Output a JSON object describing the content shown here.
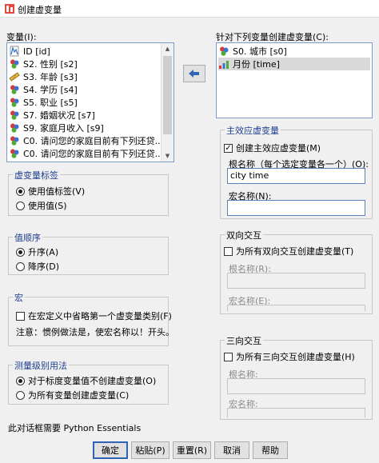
{
  "window": {
    "title": "创建虚变量"
  },
  "variables": {
    "label": "变量(I):",
    "items": [
      {
        "name": "ID [id]",
        "icon": "scale-icon"
      },
      {
        "name": "S2. 性别 [s2]",
        "icon": "nominal-icon"
      },
      {
        "name": "S3. 年龄 [s3]",
        "icon": "ruler-icon"
      },
      {
        "name": "S4. 学历 [s4]",
        "icon": "nominal-icon"
      },
      {
        "name": "S5. 职业 [s5]",
        "icon": "nominal-icon"
      },
      {
        "name": "S7. 婚姻状况 [s7]",
        "icon": "nominal-icon"
      },
      {
        "name": "S9. 家庭月收入 [s9]",
        "icon": "nominal-icon"
      },
      {
        "name": "C0. 请问您的家庭目前有下列还贷...",
        "icon": "nominal-icon"
      },
      {
        "name": "C0. 请问您的家庭目前有下列还贷...",
        "icon": "nominal-icon"
      },
      {
        "name": "C0. 请问您的家庭目前有下列还贷...",
        "icon": "nominal-icon"
      }
    ]
  },
  "target": {
    "label": "针对下列变量创建虚变量(C):",
    "items": [
      {
        "name": "S0. 城市 [s0]",
        "icon": "nominal-icon"
      },
      {
        "name": "月份 [time]",
        "icon": "ordinal-icon"
      }
    ]
  },
  "dummy_labels": {
    "title": "虚变量标签",
    "options": [
      "使用值标签(V)",
      "使用值(S)"
    ],
    "selected": 0
  },
  "value_order": {
    "title": "值顺序",
    "options": [
      "升序(A)",
      "降序(D)"
    ],
    "selected": 0
  },
  "macro": {
    "title": "宏",
    "checkbox_label": "在宏定义中省略第一个虚变量类别(F)",
    "checked": false,
    "note": "注意：惯例做法是，使宏名称以！开头。"
  },
  "measurement": {
    "title": "测量级别用法",
    "options": [
      "对于标度变量值不创建虚变量(O)",
      "为所有变量创建虚变量(C)"
    ],
    "selected": 0
  },
  "main_effects": {
    "title": "主效应虚变量",
    "checkbox_label": "创建主效应虚变量(M)",
    "checked": true,
    "root_label": "根名称（每个选定变量各一个）(O):",
    "root_value": "city time",
    "macro_label": "宏名称(N):",
    "macro_value": ""
  },
  "two_way": {
    "title": "双向交互",
    "checkbox_label": "为所有双向交互创建虚变量(T)",
    "checked": false,
    "root_label": "根名称(R):",
    "macro_label": "宏名称(E):"
  },
  "three_way": {
    "title": "三向交互",
    "checkbox_label": "为所有三向交互创建虚变量(H)",
    "checked": false,
    "root_label": "根名称:",
    "macro_label": "宏名称:"
  },
  "footer_note": "此对话框需要 Python Essentials",
  "buttons": {
    "ok": "确定",
    "paste": "粘贴(P)",
    "reset": "重置(R)",
    "cancel": "取消",
    "help": "帮助"
  },
  "colors": {
    "accent": "#2f63b6",
    "selection": "#d9d9d9"
  }
}
